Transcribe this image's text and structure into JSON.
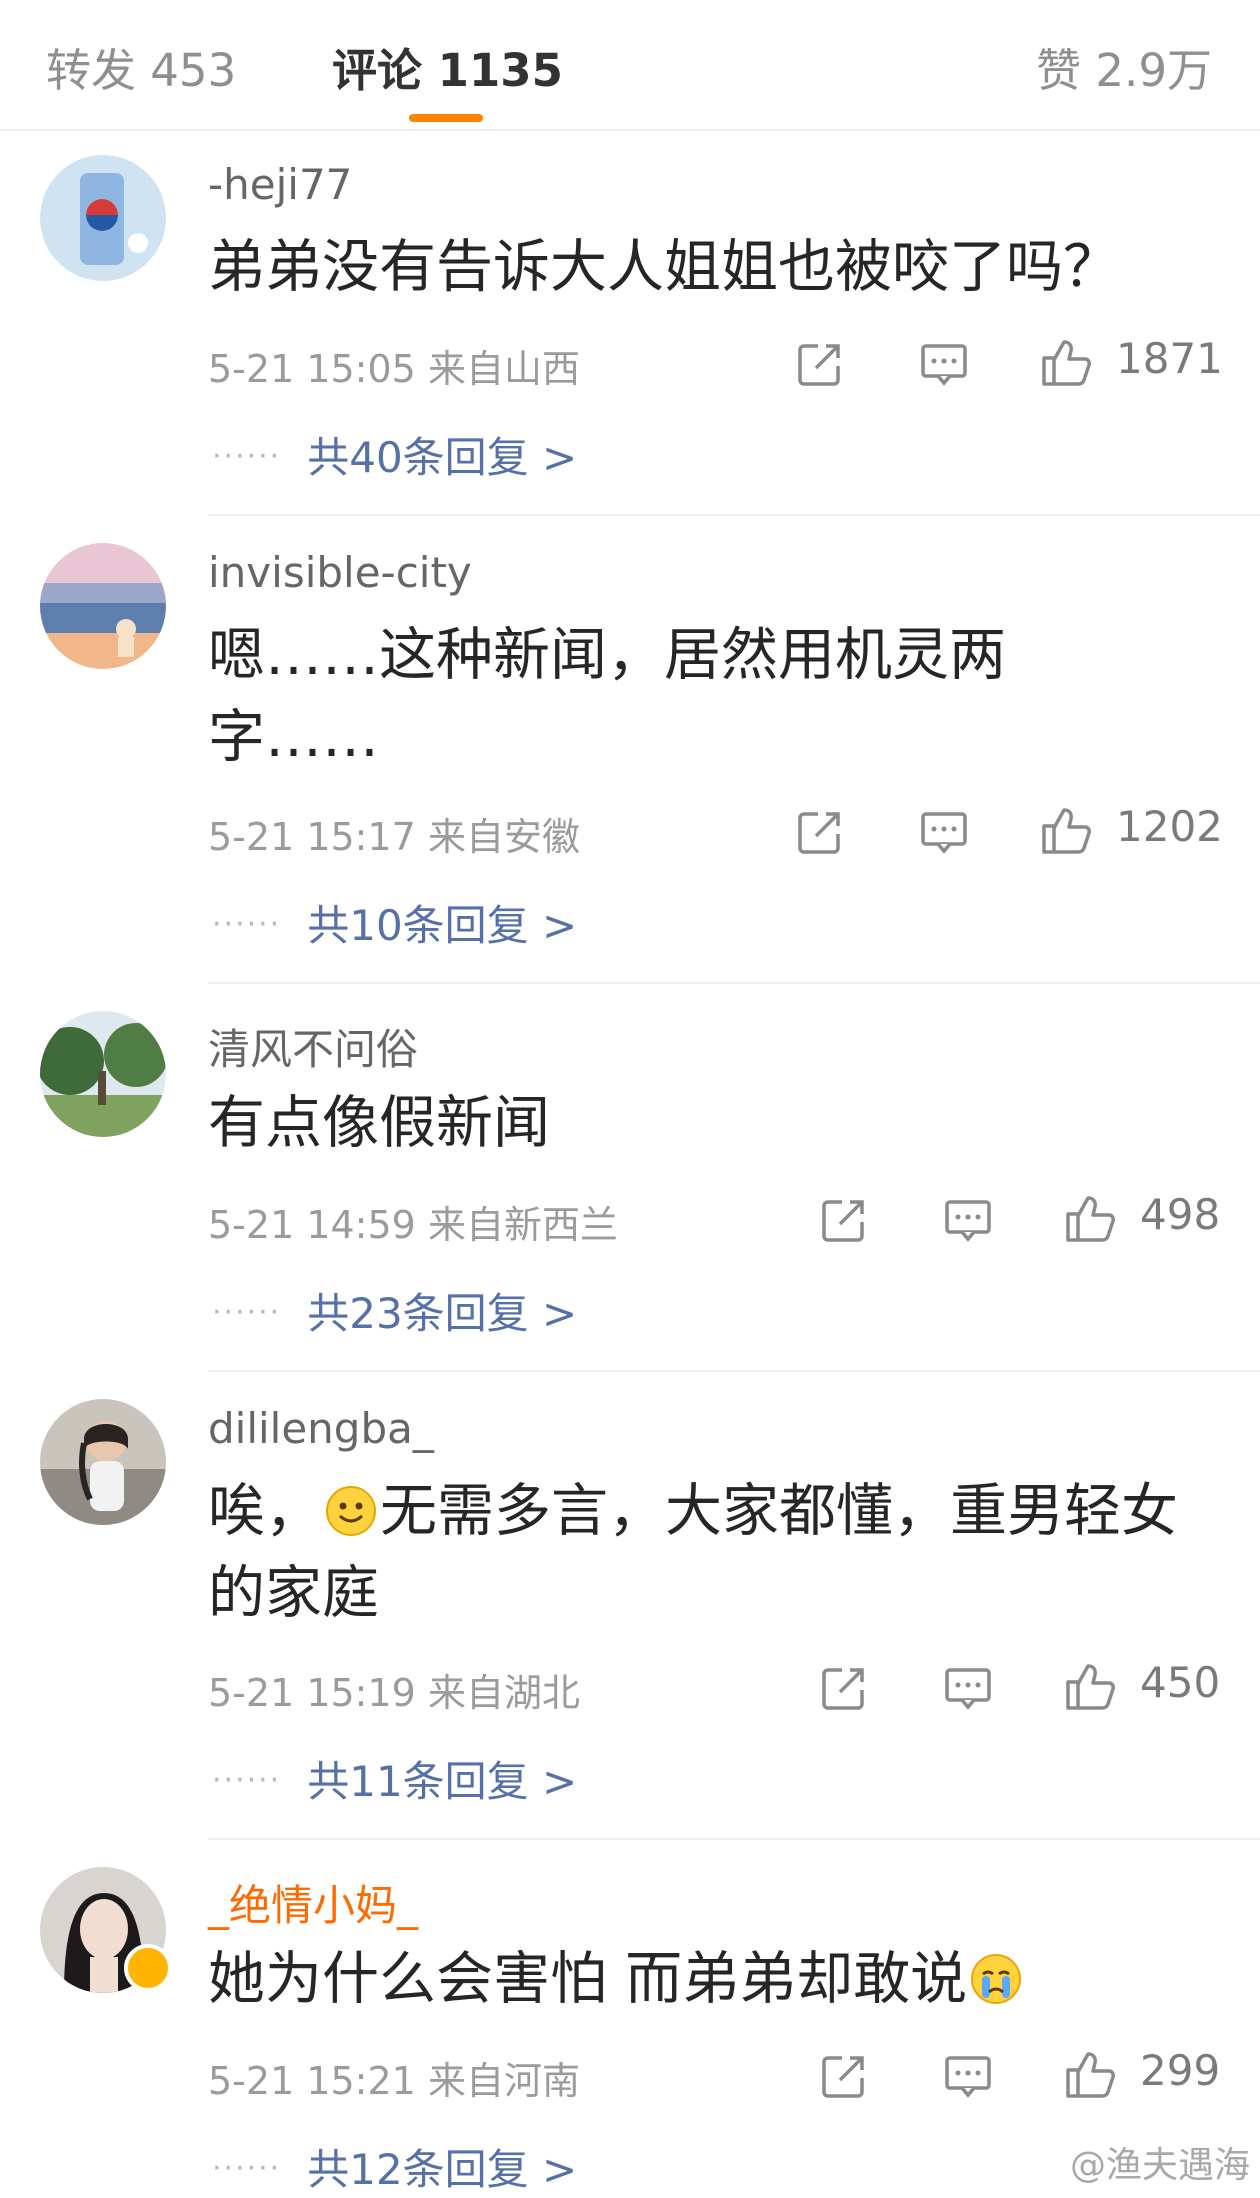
{
  "tabs": {
    "reposts": "转发 453",
    "comments": "评论 1135",
    "likes": "赞 2.9万"
  },
  "colors": {
    "accent": "#ff8200",
    "reply_link": "#5670a8",
    "vip_name": "#ff6a00"
  },
  "comments": [
    {
      "username": "-heji77",
      "text": "弟弟没有告诉大人姐姐也被咬了吗？",
      "time": "5-21 15:05",
      "location": "来自山西",
      "likes": "1871",
      "replies": "共40条回复 >"
    },
    {
      "username": "invisible-city",
      "text": "嗯……这种新闻，居然用机灵两字……",
      "time": "5-21 15:17",
      "location": "来自安徽",
      "likes": "1202",
      "replies": "共10条回复 >"
    },
    {
      "username": "清风不问俗",
      "text": "有点像假新闻",
      "time": "5-21 14:59",
      "location": "来自新西兰",
      "likes": "498",
      "replies": "共23条回复 >"
    },
    {
      "username": "dililengba_",
      "text_before": "唉，",
      "emoji": "smile-emoji",
      "text_after": "无需多言，大家都懂，重男轻女的家庭",
      "time": "5-21 15:19",
      "location": "来自湖北",
      "likes": "450",
      "replies": "共11条回复 >"
    },
    {
      "username": "_绝情小妈_",
      "text": "她为什么会害怕 而弟弟却敢说",
      "emoji": "crying-emoji",
      "time": "5-21 15:21",
      "location": "来自河南",
      "likes": "299",
      "replies": "共12条回复 >"
    }
  ],
  "watermark": "@渔夫遇海",
  "icons": {
    "repost": "repost-icon",
    "comment": "comment-icon",
    "like": "thumbs-up-icon"
  }
}
